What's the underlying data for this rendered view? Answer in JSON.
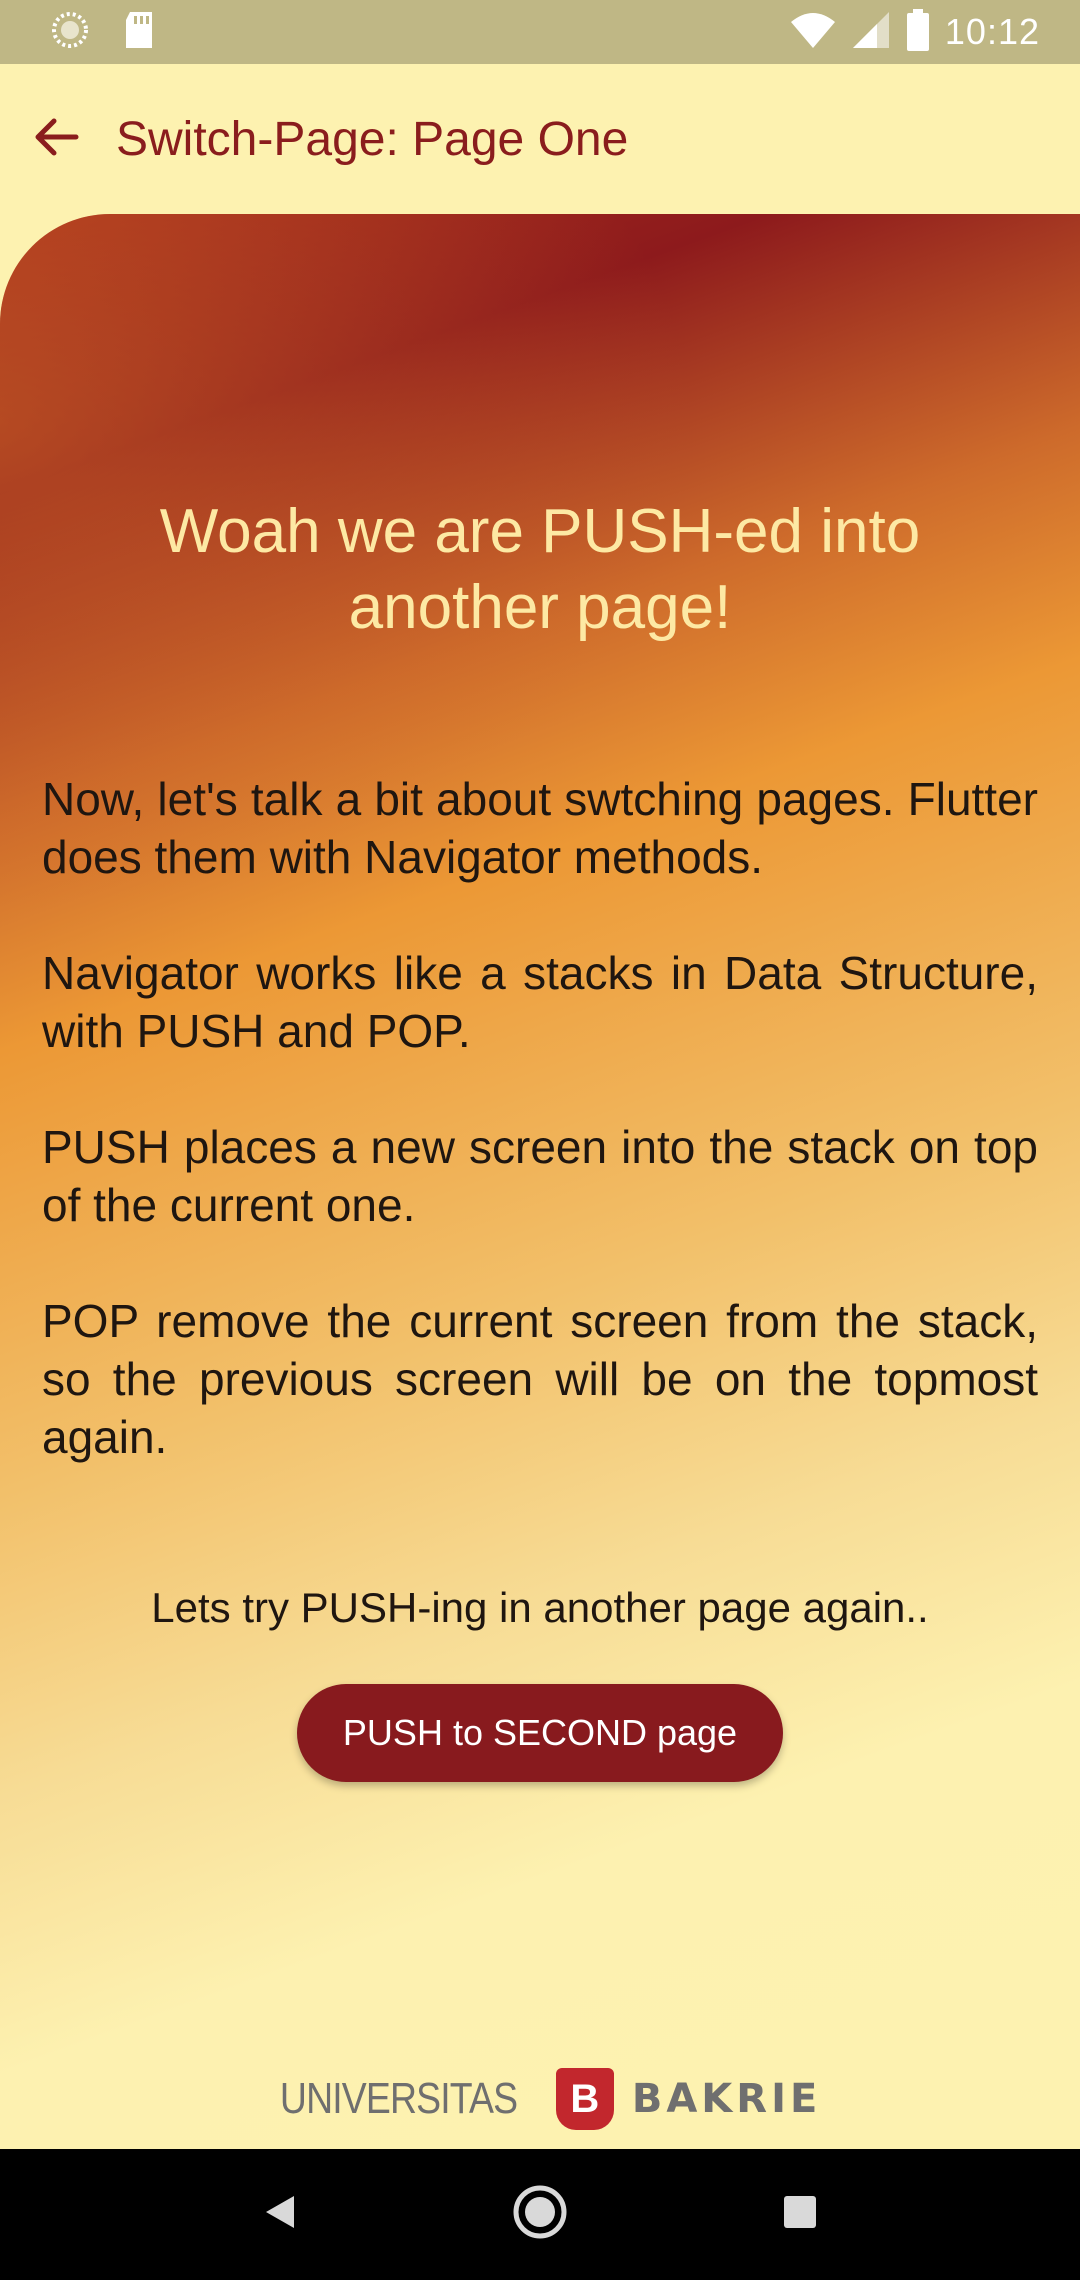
{
  "status_bar": {
    "time": "10:12",
    "icons": [
      "sync-icon",
      "sd-card-icon",
      "wifi-icon",
      "signal-icon",
      "battery-icon"
    ]
  },
  "app_bar": {
    "title": "Switch-Page: Page One",
    "back_icon": "arrow-back-icon"
  },
  "content": {
    "headline_line1": "Woah we are PUSH-ed into",
    "headline_line2": "another page!",
    "paragraphs": [
      "Now, let's talk a bit about swtching pages. Flutter does them with Navigator methods.",
      "Navigator works like a stacks in Data Structure, with PUSH and POP.",
      "PUSH places a new screen into the stack on top of the current one.",
      "POP remove the current screen from the stack, so the previous screen will be on the topmost again."
    ],
    "try_text": "Lets try PUSH-ing in another page again..",
    "push_button_label": "PUSH to SECOND page"
  },
  "footer": {
    "logo_left": "UNIVERSITAS",
    "logo_mark": "B",
    "logo_right": "BAKRIE"
  },
  "nav_bar": {
    "icons": [
      "back-triangle-icon",
      "home-circle-icon",
      "recents-square-icon"
    ]
  },
  "colors": {
    "accent": "#881a1e",
    "app_bar_bg": "#fdf2b0",
    "status_bar_bg": "#bfb785",
    "headline": "#fde9a4"
  }
}
